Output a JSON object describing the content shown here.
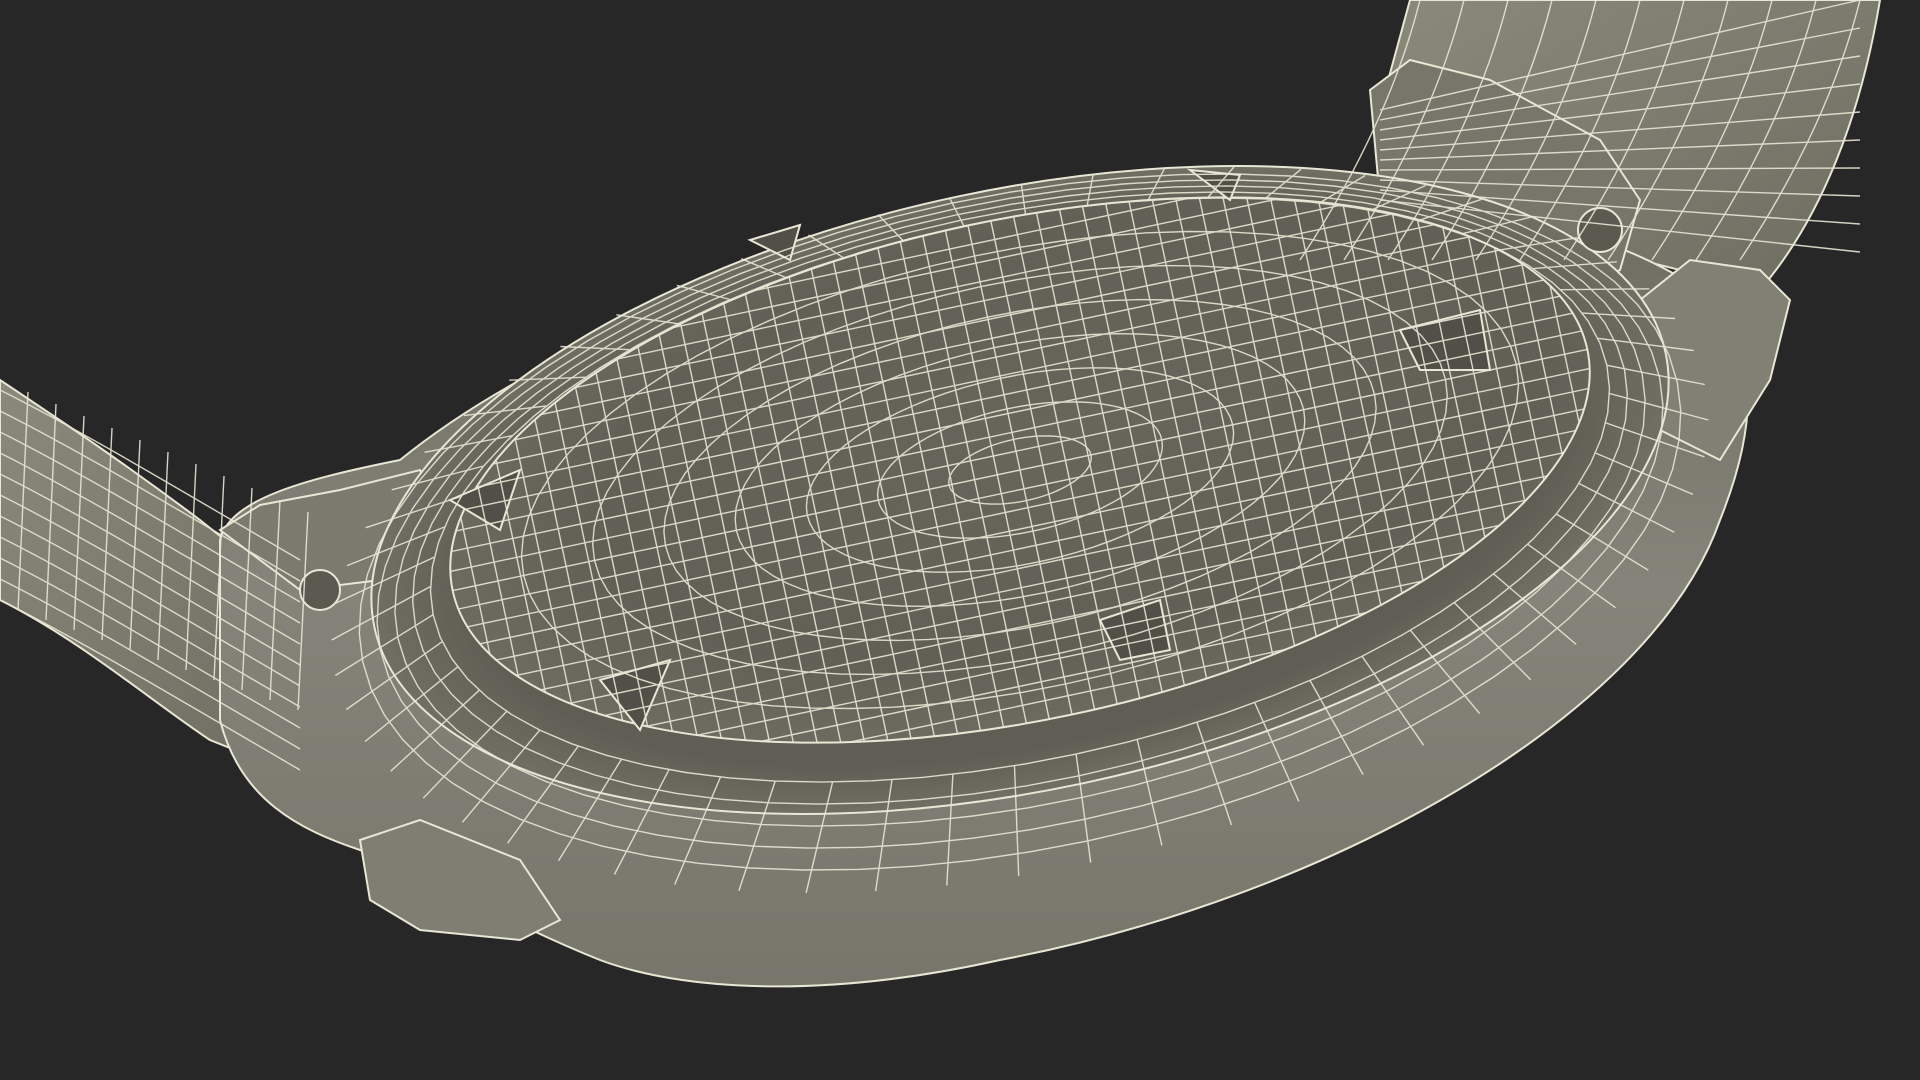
{
  "scene": {
    "subject": "watch-wireframe-render",
    "colors": {
      "background": "#272727",
      "surface_light": "#8b8b7d",
      "surface_mid": "#6f6f63",
      "surface_dark": "#55554b",
      "wire": "#e8e6d4"
    }
  }
}
